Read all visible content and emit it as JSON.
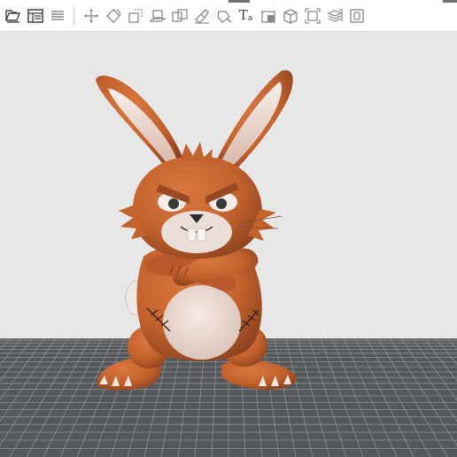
{
  "toolbar": {
    "tools": [
      {
        "id": "open",
        "icon": "folder-open-icon"
      },
      {
        "id": "layout",
        "icon": "layout-icon"
      },
      {
        "id": "list",
        "icon": "list-icon"
      },
      {
        "id": "move",
        "icon": "move-icon"
      },
      {
        "id": "rotate",
        "icon": "rotate-icon"
      },
      {
        "id": "scale",
        "icon": "scale-icon"
      },
      {
        "id": "place-on-face",
        "icon": "place-on-face-icon"
      },
      {
        "id": "cut",
        "icon": "cut-icon"
      },
      {
        "id": "support-paint",
        "icon": "support-paint-icon"
      },
      {
        "id": "seam-paint",
        "icon": "seam-paint-icon"
      },
      {
        "id": "text",
        "icon": "text-icon",
        "label": "T",
        "sub": "a"
      },
      {
        "id": "measure",
        "icon": "measure-icon"
      },
      {
        "id": "box",
        "icon": "cube-icon"
      },
      {
        "id": "fit",
        "icon": "fit-view-icon"
      },
      {
        "id": "layers",
        "icon": "layers-icon"
      },
      {
        "id": "extra",
        "icon": "object-icon"
      }
    ]
  },
  "viewport": {
    "model": "rabbit-figure",
    "colors": {
      "background": "#e7e7e7",
      "plate": "#56595b",
      "grid": "#8a8d8f",
      "fur": "#c4622e",
      "fur_dark": "#9a4a22",
      "belly": "#e8d8cf",
      "ear_inner": "#f1e6e1"
    }
  }
}
